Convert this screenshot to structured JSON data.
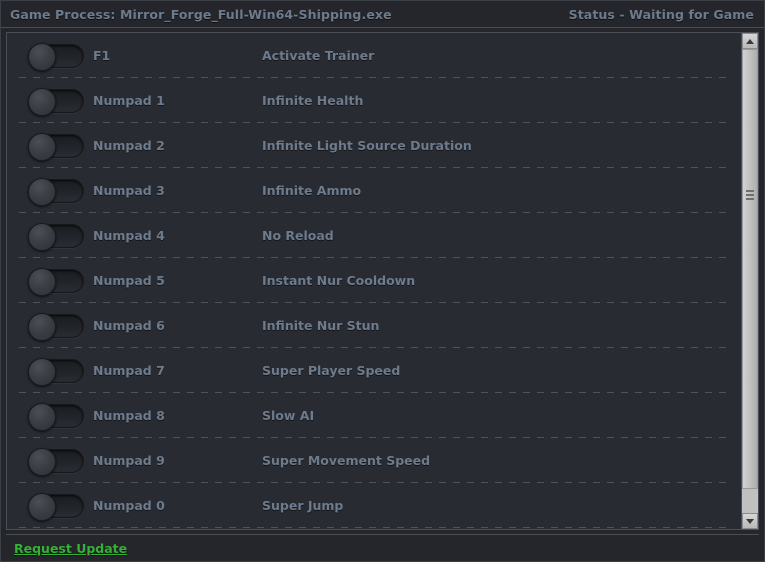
{
  "header": {
    "process_label": "Game Process: Mirror_Forge_Full-Win64-Shipping.exe",
    "status_label": "Status - Waiting for Game"
  },
  "colors": {
    "window_bg": "#24262b",
    "list_bg": "#282b31",
    "text": "#6d7b8c",
    "link_green": "#35b135",
    "border": "#4a4f57",
    "scrollbar": "#c0c0c0"
  },
  "cheats": [
    {
      "hotkey": "F1",
      "description": "Activate Trainer",
      "enabled": false
    },
    {
      "hotkey": "Numpad 1",
      "description": "Infinite Health",
      "enabled": false
    },
    {
      "hotkey": "Numpad 2",
      "description": "Infinite Light Source Duration",
      "enabled": false
    },
    {
      "hotkey": "Numpad 3",
      "description": "Infinite Ammo",
      "enabled": false
    },
    {
      "hotkey": "Numpad 4",
      "description": "No Reload",
      "enabled": false
    },
    {
      "hotkey": "Numpad 5",
      "description": "Instant Nur Cooldown",
      "enabled": false
    },
    {
      "hotkey": "Numpad 6",
      "description": "Infinite Nur Stun",
      "enabled": false
    },
    {
      "hotkey": "Numpad 7",
      "description": "Super Player Speed",
      "enabled": false
    },
    {
      "hotkey": "Numpad 8",
      "description": "Slow AI",
      "enabled": false
    },
    {
      "hotkey": "Numpad 9",
      "description": "Super Movement Speed",
      "enabled": false
    },
    {
      "hotkey": "Numpad 0",
      "description": "Super Jump",
      "enabled": false
    }
  ],
  "scrollbar": {
    "up_icon": "triangle-up-icon",
    "down_icon": "triangle-down-icon"
  },
  "footer": {
    "request_update_label": "Request Update"
  }
}
